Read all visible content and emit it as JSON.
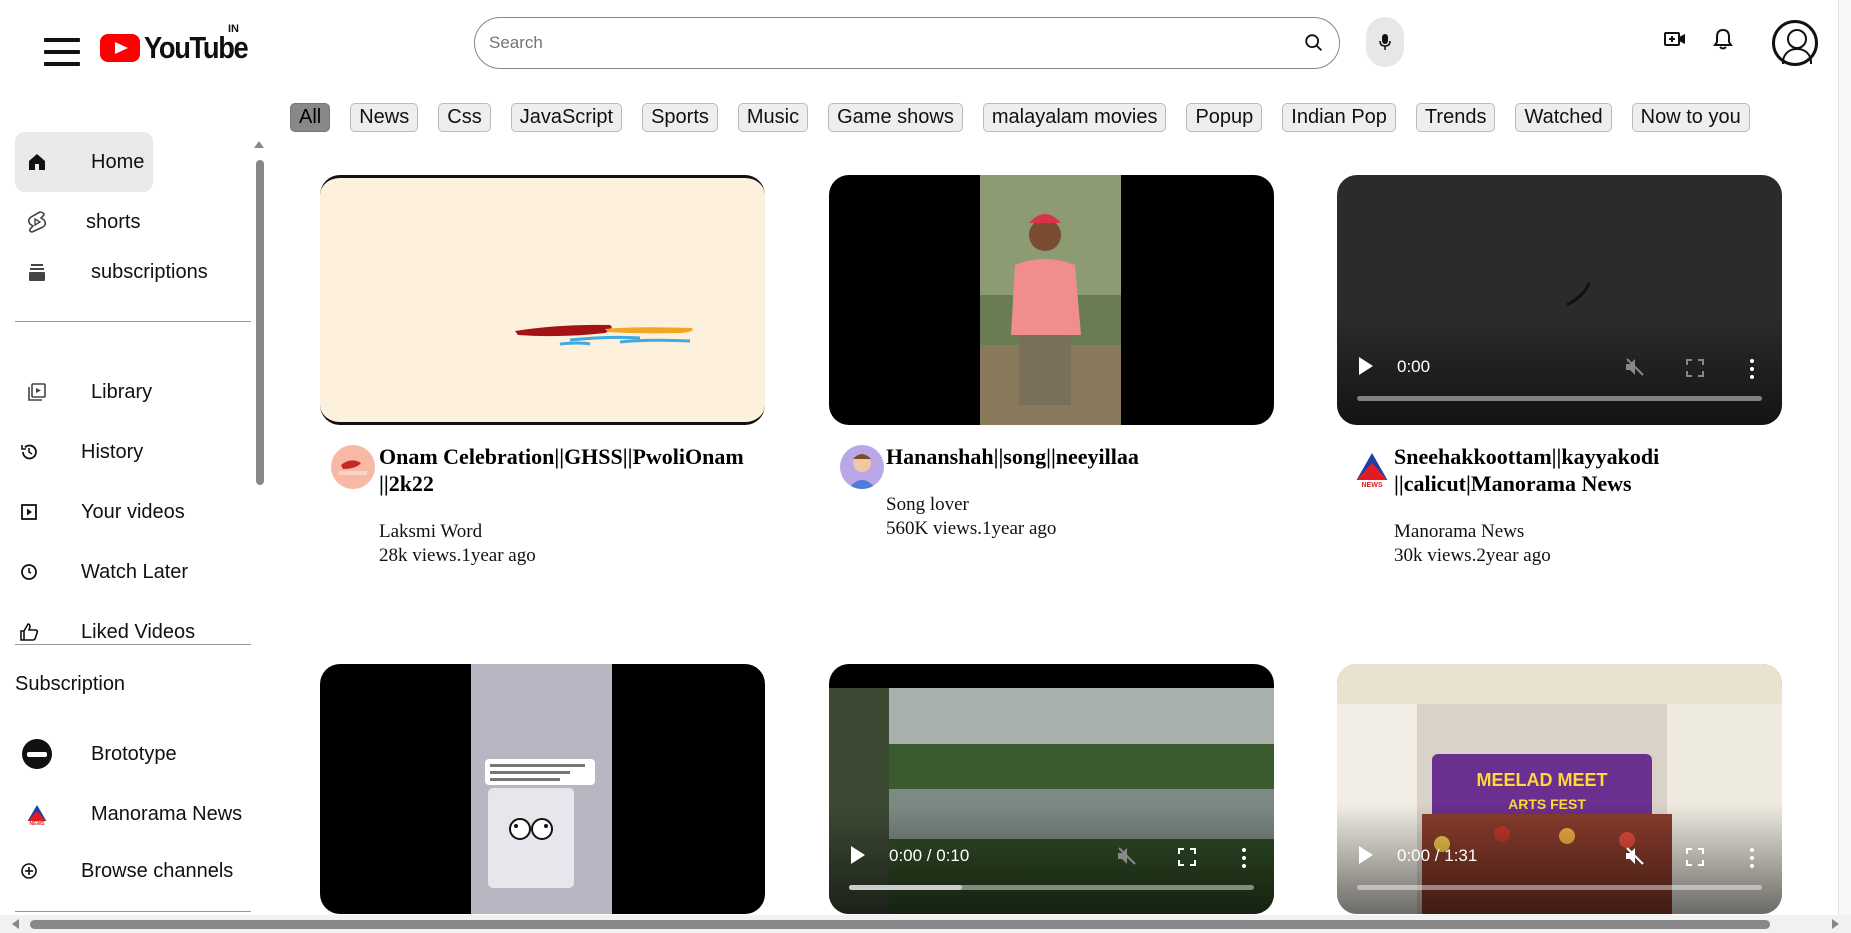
{
  "header": {
    "logo_text": "YouTube",
    "country_code": "IN",
    "search_placeholder": "Search"
  },
  "chips": [
    "All",
    "News",
    "Css",
    "JavaScript",
    "Sports",
    "Music",
    "Game shows",
    "malayalam movies",
    "Popup",
    "Indian Pop",
    "Trends",
    "Watched",
    "Now to you"
  ],
  "sidebar": {
    "home": "Home",
    "shorts": "shorts",
    "subscriptions": "subscriptions",
    "library": "Library",
    "history": "History",
    "your_videos": "Your videos",
    "watch_later": "Watch Later",
    "liked_videos": "Liked Videos",
    "subscription_heading": "Subscription",
    "sub_1": "Brototype",
    "sub_2": "Manorama News",
    "browse_channels": "Browse channels"
  },
  "videos": [
    {
      "title": "Onam Celebration||GHSS||PwoliOnam ||2k22",
      "channel": "Laksmi Word",
      "stats": "28k views.1year ago"
    },
    {
      "title": "Hananshah||song||neeyillaa",
      "channel": "Song lover",
      "stats": "560K views.1year ago"
    },
    {
      "title": "Sneehakkoottam||kayyakodi ||calicut|Manorama News",
      "channel": "Manorama News",
      "stats": "30k views.2year ago",
      "player_time": "0:00"
    },
    {
      "title": "",
      "channel": "",
      "stats": ""
    },
    {
      "title": "",
      "channel": "",
      "stats": "",
      "player_time": "0:00 / 0:10",
      "progress": 0.28
    },
    {
      "title": "",
      "channel": "",
      "stats": "",
      "player_time": "0:00 / 1:31",
      "progress": 0.0
    }
  ],
  "colors": {
    "logo_red": "#ff0000",
    "active_chip": "#888888"
  }
}
